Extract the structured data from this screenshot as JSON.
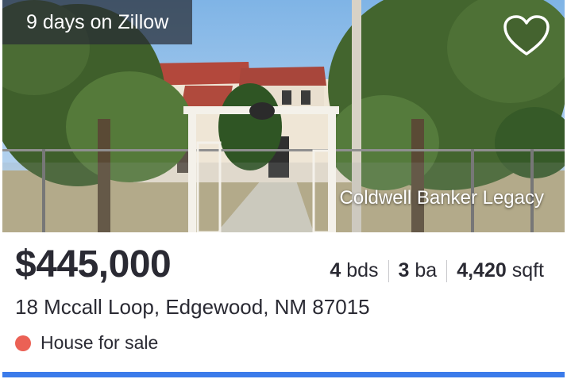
{
  "listing": {
    "days_on_market": "9 days on Zillow",
    "photo_watermark": "Coldwell Banker Legacy",
    "price": "$445,000",
    "beds_value": "4",
    "beds_unit": "bds",
    "baths_value": "3",
    "baths_unit": "ba",
    "sqft_value": "4,420",
    "sqft_unit": "sqft",
    "address": "18 Mccall Loop, Edgewood, NM 87015",
    "status": "House for sale"
  },
  "icons": {
    "favorite": "heart-outline-icon",
    "status": "status-dot"
  },
  "colors": {
    "status_dot": "#eb6155",
    "accent_bar": "#3b7bea",
    "text": "#2a2a33"
  }
}
